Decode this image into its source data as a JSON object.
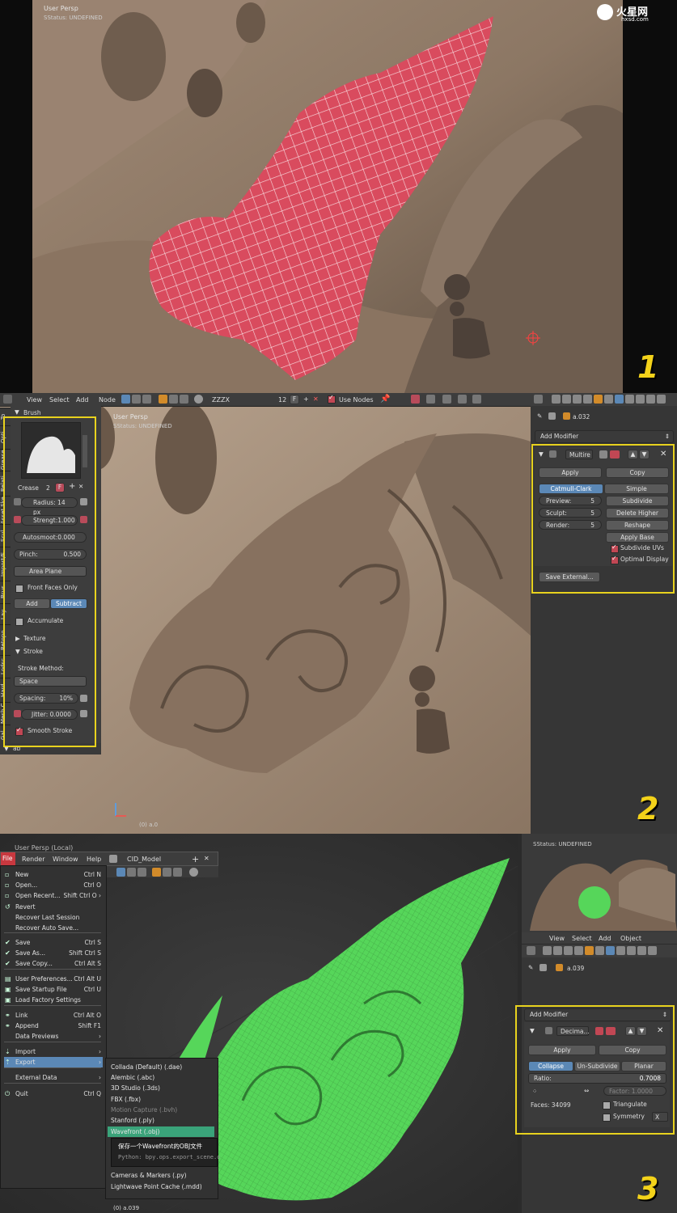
{
  "watermark": {
    "brand": "火星网",
    "url": "hxsd.com"
  },
  "panel1": {
    "view_label": "User Persp",
    "status": "SStatus: UNDEFINED",
    "step": "1"
  },
  "panel2": {
    "step": "2",
    "header": {
      "menus": [
        "View",
        "Select",
        "Add",
        "Node"
      ],
      "material": "ZZZX",
      "users": "12",
      "fake": "F",
      "use_nodes_label": "Use Nodes"
    },
    "viewport": {
      "view_label": "User Persp",
      "status": "SStatus: UNDEFINED",
      "object": "(0) a.0"
    },
    "tabs": [
      "To",
      "Opti",
      "Grease",
      "Relati",
      "Asset Ske",
      "Scul",
      "Import/E",
      "Brus",
      "Lay",
      "Retopo",
      "Lodsc",
      "Hard",
      "Mesh C",
      "Gal"
    ],
    "brush": {
      "section": "Brush",
      "crease_label": "Crease",
      "crease_users": "2",
      "crease_fake": "F",
      "radius": "Radius: 14 px",
      "strength": "Strengt:1.000",
      "autosmooth": "Autosmoot:0.000",
      "pinch_label": "Pinch:",
      "pinch_value": "0.500",
      "plane": "Area Plane",
      "front_faces": "Front Faces Only",
      "add": "Add",
      "subtract": "Subtract",
      "accumulate": "Accumulate",
      "texture": "Texture",
      "stroke": "Stroke",
      "stroke_method_label": "Stroke Method:",
      "stroke_method": "Space",
      "spacing_label": "Spacing:",
      "spacing_value": "10%",
      "jitter": "Jitter: 0.0000",
      "smooth_stroke": "Smooth Stroke",
      "bottom_section": "ab"
    },
    "properties": {
      "object_name": "a.032",
      "add_modifier": "Add Modifier",
      "modifier_name": "Multire",
      "apply": "Apply",
      "copy": "Copy",
      "catmull": "Catmull-Clark",
      "simple": "Simple",
      "preview_label": "Preview:",
      "preview_value": "5",
      "sculpt_label": "Sculpt:",
      "sculpt_value": "5",
      "render_label": "Render:",
      "render_value": "5",
      "subdivide": "Subdivide",
      "delete_higher": "Delete Higher",
      "reshape": "Reshape",
      "apply_base": "Apply Base",
      "subdivide_uvs": "Subdivide UVs",
      "optimal_display": "Optimal Display",
      "save_external": "Save External..."
    }
  },
  "panel3": {
    "step": "3",
    "view_label": "User Persp (Local)",
    "object_label": "(0) a.039",
    "menubar": [
      "File",
      "Render",
      "Window",
      "Help"
    ],
    "scene_name": "CID_Model",
    "file_menu": [
      {
        "label": "New",
        "shortcut": "Ctrl N",
        "icon": "▫"
      },
      {
        "label": "Open...",
        "shortcut": "Ctrl O",
        "icon": "▫"
      },
      {
        "label": "Open Recent...",
        "shortcut": "Shift Ctrl O ›",
        "icon": "▫"
      },
      {
        "label": "Revert",
        "shortcut": "",
        "icon": "↺"
      },
      {
        "label": "Recover Last Session",
        "shortcut": "",
        "icon": ""
      },
      {
        "label": "Recover Auto Save...",
        "shortcut": "",
        "icon": ""
      },
      {
        "label": "Save",
        "shortcut": "Ctrl S",
        "icon": "✔"
      },
      {
        "label": "Save As...",
        "shortcut": "Shift Ctrl S",
        "icon": "✔"
      },
      {
        "label": "Save Copy...",
        "shortcut": "Ctrl Alt S",
        "icon": "✔"
      },
      {
        "label": "User Preferences...",
        "shortcut": "Ctrl Alt U",
        "icon": "▤"
      },
      {
        "label": "Save Startup File",
        "shortcut": "Ctrl U",
        "icon": "▣"
      },
      {
        "label": "Load Factory Settings",
        "shortcut": "",
        "icon": "▣"
      },
      {
        "label": "Link",
        "shortcut": "Ctrl Alt O",
        "icon": "⚭"
      },
      {
        "label": "Append",
        "shortcut": "Shift F1",
        "icon": "⚭"
      },
      {
        "label": "Data Previews",
        "shortcut": "›",
        "icon": ""
      },
      {
        "label": "Import",
        "shortcut": "›",
        "icon": "⇣"
      },
      {
        "label": "Export",
        "shortcut": "›",
        "icon": "⇡"
      },
      {
        "label": "External Data",
        "shortcut": "›",
        "icon": ""
      },
      {
        "label": "Quit",
        "shortcut": "Ctrl Q",
        "icon": "⏻"
      }
    ],
    "export_menu": [
      "Collada (Default) (.dae)",
      "Alembic (.abc)",
      "3D Studio (.3ds)",
      "FBX (.fbx)",
      "Motion Capture (.bvh)",
      "Stanford (.ply)",
      "Wavefront (.obj)",
      "Cameras & Markers (.py)",
      "Lightwave Point Cache (.mdd)"
    ],
    "tooltip": {
      "title": "保存一个Wavefront的OBJ文件",
      "python": "Python: bpy.ops.export_scene.o"
    },
    "mini_view": {
      "status": "SStatus: UNDEFINED",
      "menus": [
        "View",
        "Select",
        "Add",
        "Object"
      ]
    },
    "properties": {
      "object_name": "a.039",
      "add_modifier": "Add Modifier",
      "modifier_name": "Decima...",
      "apply": "Apply",
      "copy": "Copy",
      "collapse": "Collapse",
      "unsubdivide": "Un-Subdivide",
      "planar": "Planar",
      "ratio_label": "Ratio:",
      "ratio_value": "0.7008",
      "factor": "Factor: 1.0000",
      "faces": "Faces: 34099",
      "triangulate": "Triangulate",
      "symmetry": "Symmetry",
      "axis": "X"
    }
  },
  "colors": {
    "accent_yellow": "#e8d21e",
    "selection_red": "#d94b5e",
    "wire_green": "#56d65a",
    "blender_blue": "#5b88b6"
  }
}
